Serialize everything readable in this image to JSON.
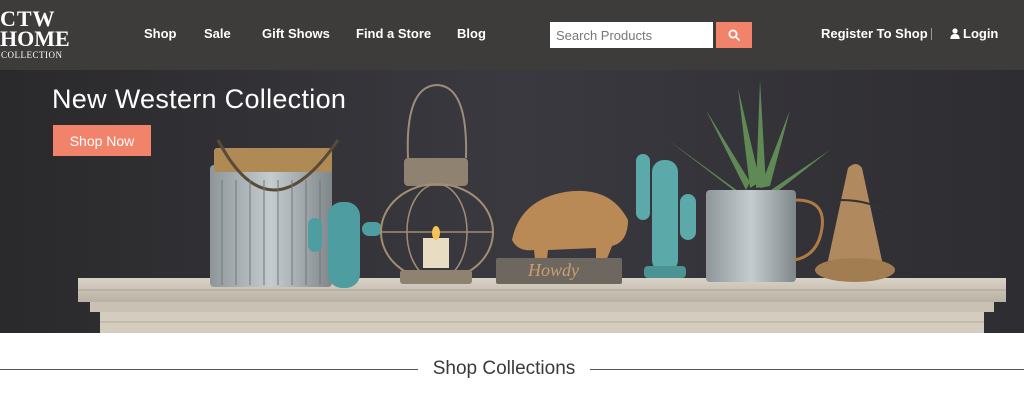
{
  "header": {
    "logo": {
      "line1": "CTW",
      "line2": "HOME",
      "line3": "COLLECTION"
    },
    "nav": [
      "Shop",
      "Sale",
      "Gift Shows",
      "Find a Store",
      "Blog"
    ],
    "search": {
      "placeholder": "Search Products",
      "icon": "search-icon"
    },
    "register_label": "Register To Shop",
    "login_label": "Login",
    "login_icon": "user-icon"
  },
  "hero": {
    "title": "New Western Collection",
    "cta_label": "Shop Now",
    "accent_color": "#f2836b"
  },
  "section": {
    "title": "Shop Collections"
  }
}
